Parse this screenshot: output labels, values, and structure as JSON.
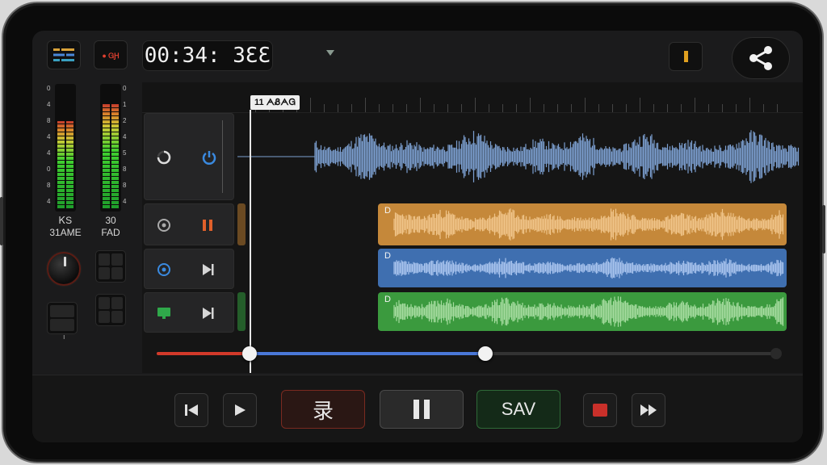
{
  "timecode": "00:34: 3ƐƐ",
  "top_rec_label": "● ᏀԨ",
  "marker_label": "11 ᗅᏰᗅᏀ",
  "meters": {
    "scale_left": [
      "0",
      "4",
      "8",
      "4",
      "4",
      "0",
      "8",
      "4"
    ],
    "scale_right": [
      "0",
      "1",
      "2",
      "4",
      "5",
      "8",
      "8",
      "4"
    ],
    "channel_a": {
      "line1": "ᏦS",
      "line2": "31AME",
      "level": 0.72
    },
    "channel_b": {
      "line1": "30",
      "line2": "FAD",
      "level": 0.86
    }
  },
  "pad_mark": "ı",
  "tracks": [
    {
      "name": "track-1",
      "clip_label": "",
      "color": "#7c9fd0"
    },
    {
      "name": "track-2",
      "clip_label": "D",
      "color": "#c9893a"
    },
    {
      "name": "track-3",
      "clip_label": "D",
      "color": "#3f6fb0"
    },
    {
      "name": "track-4",
      "clip_label": "D",
      "color": "#3b9a3e"
    }
  ],
  "position_slider": {
    "start": 0.15,
    "end": 0.53
  },
  "transport": {
    "record_label": "录",
    "pause_label": "❚❚",
    "save_label": "SAV"
  },
  "colors": {
    "accent_blue": "#4a78d8",
    "record_red": "#d23a2a",
    "save_green": "#2f8a3c"
  }
}
